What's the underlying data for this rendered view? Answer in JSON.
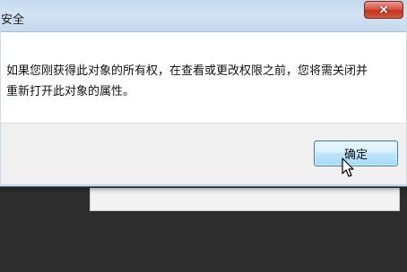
{
  "dialog": {
    "title": "安全",
    "close_glyph": "×",
    "message_lines": [
      "如果您刚获得此对象的所有权，在查看或更改权限之前，您将需关闭并",
      "重新打开此对象的属性。"
    ],
    "ok_label": "确定"
  },
  "colors": {
    "titlebar": "#c9daed",
    "close_button": "#c2331f",
    "ok_button_border": "#3c7fb1",
    "footer": "#f0f0f0",
    "background_dark": "#2d2d2d"
  },
  "icons": {
    "close": "close-icon",
    "cursor": "mouse-pointer-icon"
  }
}
